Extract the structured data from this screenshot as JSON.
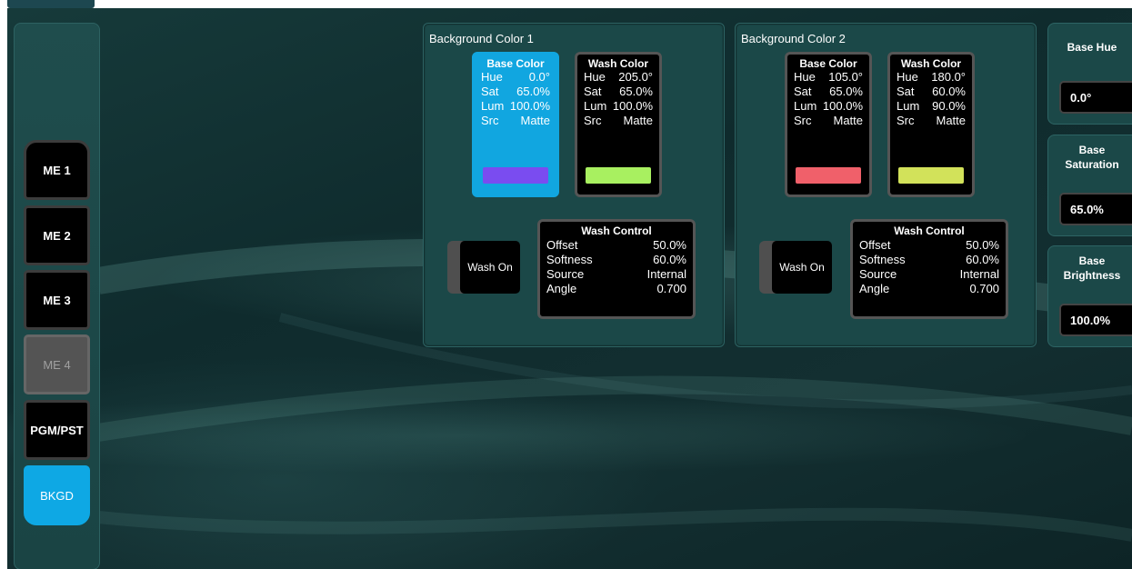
{
  "me_buttons": [
    {
      "label": "ME 1",
      "state": "normal"
    },
    {
      "label": "ME 2",
      "state": "normal"
    },
    {
      "label": "ME 3",
      "state": "normal"
    },
    {
      "label": "ME 4",
      "state": "disabled"
    },
    {
      "label": "PGM/PST",
      "state": "normal"
    },
    {
      "label": "BKGD",
      "state": "selected"
    }
  ],
  "bg1": {
    "title": "Background Color 1",
    "base": {
      "title": "Base Color",
      "hue_l": "Hue",
      "hue": "0.0°",
      "sat_l": "Sat",
      "sat": "65.0%",
      "lum_l": "Lum",
      "lum": "100.0%",
      "src_l": "Src",
      "src": "Matte",
      "swatch": "#7a4cf0"
    },
    "wash": {
      "title": "Wash Color",
      "hue_l": "Hue",
      "hue": "205.0°",
      "sat_l": "Sat",
      "sat": "65.0%",
      "lum_l": "Lum",
      "lum": "100.0%",
      "src_l": "Src",
      "src": "Matte",
      "swatch": "#a8f060"
    },
    "wash_toggle": "Wash On",
    "ctrl": {
      "title": "Wash Control",
      "offset_l": "Offset",
      "offset": "50.0%",
      "soft_l": "Softness",
      "soft": "60.0%",
      "source_l": "Source",
      "source": "Internal",
      "angle_l": "Angle",
      "angle": "0.700"
    }
  },
  "bg2": {
    "title": "Background Color 2",
    "base": {
      "title": "Base Color",
      "hue_l": "Hue",
      "hue": "105.0°",
      "sat_l": "Sat",
      "sat": "65.0%",
      "lum_l": "Lum",
      "lum": "100.0%",
      "src_l": "Src",
      "src": "Matte",
      "swatch": "#f0606a"
    },
    "wash": {
      "title": "Wash Color",
      "hue_l": "Hue",
      "hue": "180.0°",
      "sat_l": "Sat",
      "sat": "60.0%",
      "lum_l": "Lum",
      "lum": "90.0%",
      "src_l": "Src",
      "src": "Matte",
      "swatch": "#d2e25a"
    },
    "wash_toggle": "Wash On",
    "ctrl": {
      "title": "Wash Control",
      "offset_l": "Offset",
      "offset": "50.0%",
      "soft_l": "Softness",
      "soft": "60.0%",
      "source_l": "Source",
      "source": "Internal",
      "angle_l": "Angle",
      "angle": "0.700"
    }
  },
  "params": {
    "hue": {
      "label": "Base Hue",
      "value": "0.0°"
    },
    "sat": {
      "label1": "Base",
      "label2": "Saturation",
      "value": "65.0%"
    },
    "bri": {
      "label1": "Base",
      "label2": "Brightness",
      "value": "100.0%"
    }
  }
}
